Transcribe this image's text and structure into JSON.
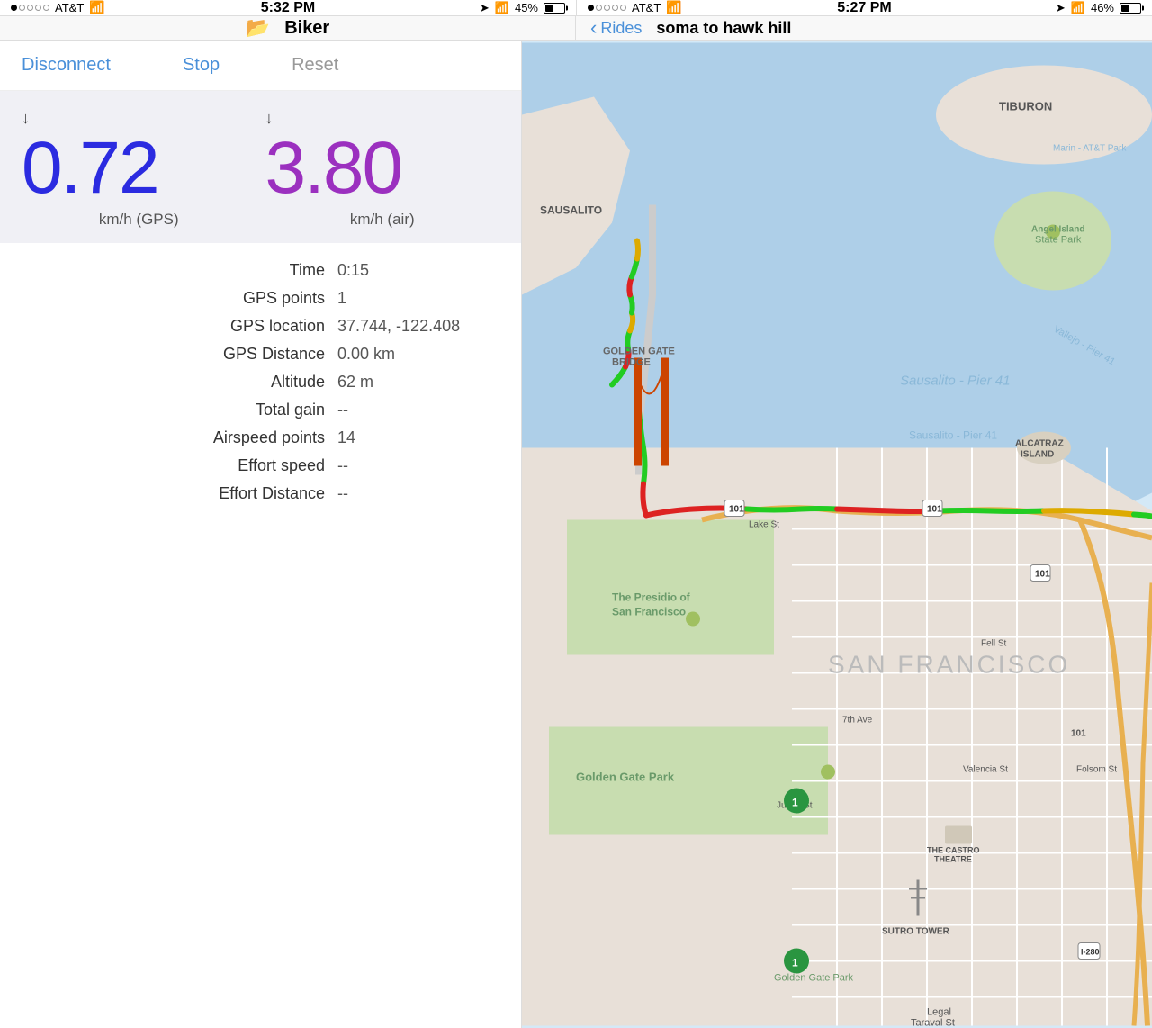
{
  "status_bar_left": {
    "carrier": "AT&T",
    "time": "5:32 PM",
    "battery": "45%",
    "signal_dots": [
      true,
      false,
      false,
      false,
      false
    ]
  },
  "status_bar_right": {
    "carrier": "AT&T",
    "time": "5:27 PM",
    "battery": "46%",
    "signal_dots": [
      true,
      false,
      false,
      false,
      false
    ]
  },
  "nav_left": {
    "title": "Biker"
  },
  "nav_right": {
    "back_label": "Rides",
    "ride_title": "soma to hawk hill"
  },
  "actions": {
    "disconnect": "Disconnect",
    "stop": "Stop",
    "reset": "Reset"
  },
  "speed": {
    "gps_value": "0.72",
    "gps_unit": "km/h (GPS)",
    "air_value": "3.80",
    "air_unit": "km/h (air)"
  },
  "stats": [
    {
      "label": "Time",
      "value": "0:15"
    },
    {
      "label": "GPS points",
      "value": "1"
    },
    {
      "label": "GPS location",
      "value": "37.744, -122.408"
    },
    {
      "label": "GPS Distance",
      "value": "0.00 km"
    },
    {
      "label": "Altitude",
      "value": "62 m"
    },
    {
      "label": "Total gain",
      "value": "--"
    },
    {
      "label": "Airspeed points",
      "value": "14"
    },
    {
      "label": "Effort speed",
      "value": "--"
    },
    {
      "label": "Effort Distance",
      "value": "--"
    }
  ],
  "map": {
    "area": "San Francisco Bay Area"
  }
}
